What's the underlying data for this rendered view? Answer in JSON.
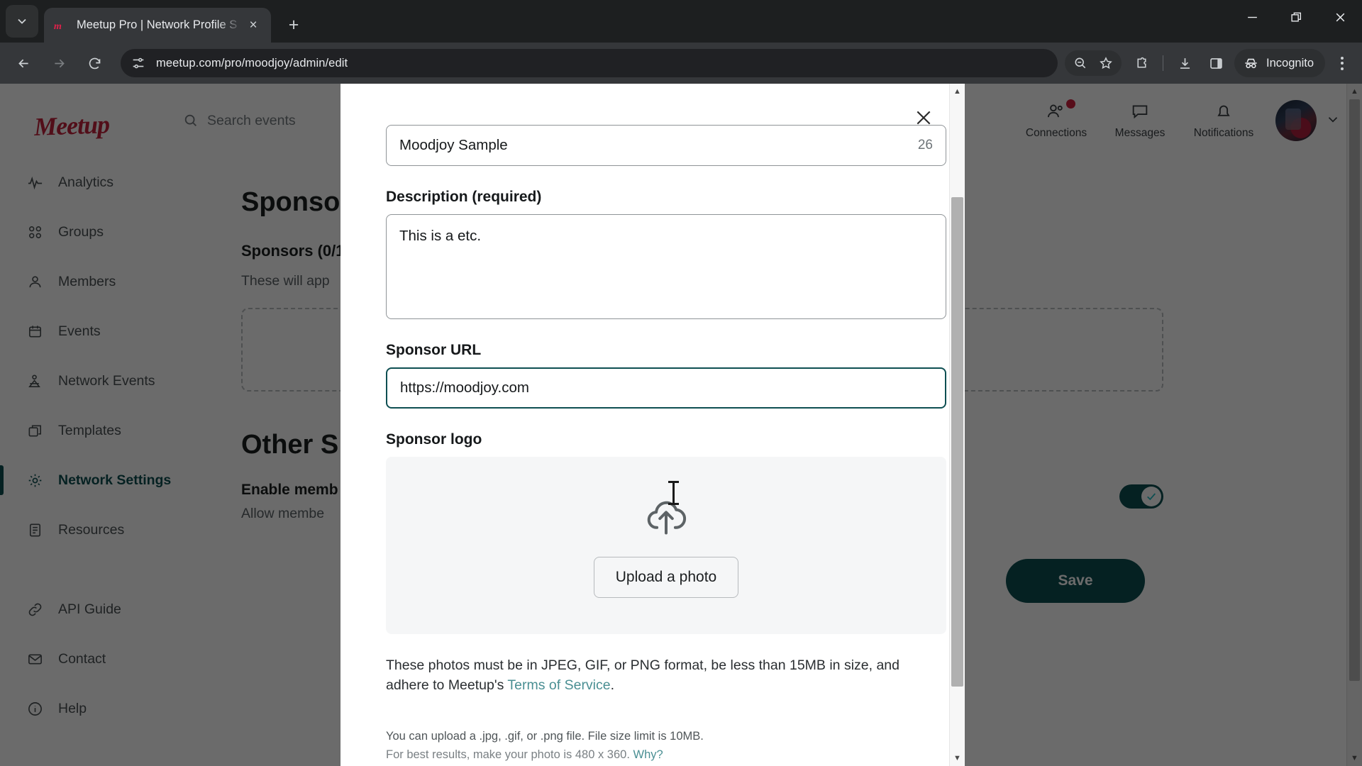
{
  "browser": {
    "tab": {
      "title": "Meetup Pro | Network Profile S",
      "favicon": "meetup-favicon"
    },
    "new_tab_label": "+",
    "close_tab_label": "×",
    "url": "meetup.com/pro/moodjoy/admin/edit",
    "incognito_label": "Incognito",
    "window": {
      "minimize": "—",
      "maximize": "❐",
      "close": "✕"
    },
    "toolbar_icons": [
      "zoom-out-icon",
      "bookmark-star-icon",
      "extensions-icon",
      "downloads-icon",
      "side-panel-icon",
      "incognito-icon",
      "chrome-menu-icon"
    ],
    "nav_icons": [
      "back-arrow-icon",
      "forward-arrow-icon",
      "reload-icon",
      "site-settings-icon"
    ]
  },
  "sidebar": {
    "brand": "Meetup",
    "items": [
      {
        "label": "Analytics",
        "icon": "analytics-icon",
        "active": false
      },
      {
        "label": "Groups",
        "icon": "groups-icon",
        "active": false
      },
      {
        "label": "Members",
        "icon": "members-icon",
        "active": false
      },
      {
        "label": "Events",
        "icon": "calendar-icon",
        "active": false
      },
      {
        "label": "Network Events",
        "icon": "network-events-icon",
        "active": false
      },
      {
        "label": "Templates",
        "icon": "templates-icon",
        "active": false
      },
      {
        "label": "Network Settings",
        "icon": "gear-icon",
        "active": true
      },
      {
        "label": "Resources",
        "icon": "document-icon",
        "active": false
      }
    ],
    "footer_items": [
      {
        "label": "API Guide",
        "icon": "link-icon"
      },
      {
        "label": "Contact",
        "icon": "mail-icon"
      },
      {
        "label": "Help",
        "icon": "info-icon"
      }
    ]
  },
  "header": {
    "search_placeholder": "Search events",
    "items": [
      {
        "label": "Connections",
        "icon": "connections-icon",
        "badge": true
      },
      {
        "label": "Messages",
        "icon": "message-icon",
        "badge": false
      },
      {
        "label": "Notifications",
        "icon": "bell-icon",
        "badge": false
      }
    ]
  },
  "main": {
    "title": "Sponsors",
    "sponsors_heading": "Sponsors (0/1",
    "sponsors_sub": "These will app",
    "other_title": "Other S",
    "setting_title": "Enable memb",
    "setting_sub": "Allow membe",
    "save_label": "Save"
  },
  "modal": {
    "close_label": "✕",
    "name": {
      "value": "Moodjoy Sample",
      "char_count": "26"
    },
    "description": {
      "label": "Description (required)",
      "value": "This is a etc."
    },
    "sponsor_url": {
      "label": "Sponsor URL",
      "value": "https://moodjoy.com"
    },
    "sponsor_logo": {
      "label": "Sponsor logo",
      "upload_button": "Upload a photo",
      "upload_icon": "cloud-upload-icon"
    },
    "notes": {
      "formats_prefix": "These photos must be in JPEG, GIF, or PNG format, be less than 15MB in size, and adhere to Meetup's ",
      "terms_link": "Terms of Service",
      "formats_suffix": ".",
      "small_line1": "You can upload a .jpg, .gif, or .png file. File size limit is 10MB.",
      "small_line2": "For best results, make your photo is 480 x 360. ",
      "why_link": "Why?"
    }
  },
  "colors": {
    "brand_red": "#c4223c",
    "accent_teal": "#0e4f52",
    "link_teal": "#4a8f93",
    "chrome_bg": "#35373a"
  }
}
